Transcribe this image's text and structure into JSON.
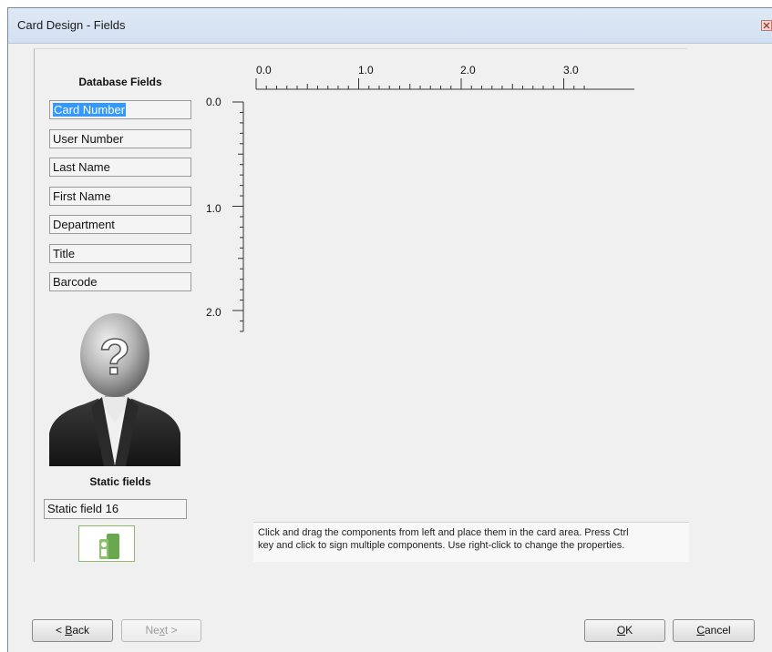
{
  "window": {
    "title": "Card Design - Fields"
  },
  "database_fields": {
    "heading": "Database Fields",
    "items": [
      {
        "label": "Card Number",
        "selected": true
      },
      {
        "label": "User Number",
        "selected": false
      },
      {
        "label": "Last Name",
        "selected": false
      },
      {
        "label": "First Name",
        "selected": false
      },
      {
        "label": "Department",
        "selected": false
      },
      {
        "label": "Title",
        "selected": false
      },
      {
        "label": "Barcode",
        "selected": false
      }
    ]
  },
  "photo": {
    "icon": "unknown-person-icon",
    "glyph": "?"
  },
  "static_fields": {
    "heading": "Static fields",
    "items": [
      {
        "label": "Static field 16"
      }
    ]
  },
  "logo_tile": {
    "icon": "logo-icon"
  },
  "rulers": {
    "horizontal_labels": [
      "0.0",
      "1.0",
      "2.0",
      "3.0"
    ],
    "vertical_labels": [
      "0.0",
      "1.0",
      "2.0"
    ]
  },
  "hint": {
    "line1": "Click and drag the components from left and place them in the card area. Press Ctrl",
    "line2": "key and click to sign multiple components. Use right-click to change the properties."
  },
  "buttons": {
    "back": {
      "pre": "< ",
      "key": "B",
      "post": "ack",
      "enabled": true
    },
    "next": {
      "pre": "Ne",
      "key": "x",
      "post": "t >",
      "enabled": false
    },
    "ok": {
      "pre": "",
      "key": "O",
      "post": "K",
      "enabled": true
    },
    "cancel": {
      "pre": "",
      "key": "C",
      "post": "ancel",
      "enabled": true
    }
  },
  "colors": {
    "selection": "#3399ff",
    "logo_green": "#6aa84f"
  }
}
